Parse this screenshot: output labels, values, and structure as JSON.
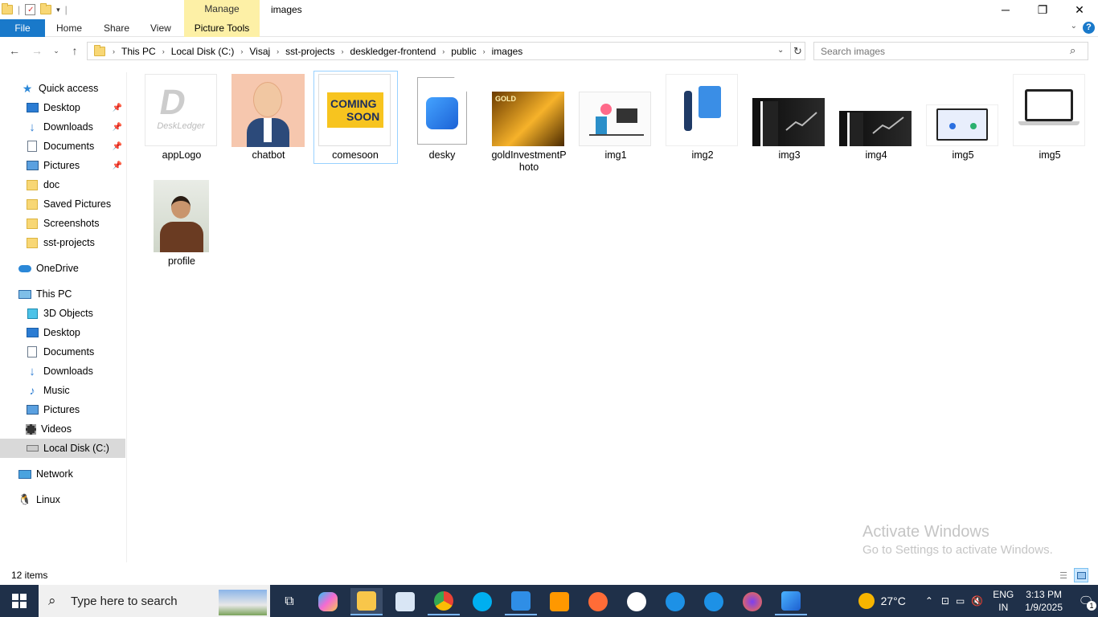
{
  "window": {
    "title": "images",
    "contextual_tab": "Manage",
    "contextual_group": "Picture Tools",
    "controls": {
      "minimize": "─",
      "maximize": "❐",
      "close": "✕"
    }
  },
  "ribbon": {
    "file": "File",
    "tabs": [
      "Home",
      "Share",
      "View"
    ],
    "picture_tools": "Picture Tools",
    "help": "?"
  },
  "address": {
    "crumbs": [
      "This PC",
      "Local Disk (C:)",
      "Visaj",
      "sst-projects",
      "deskledger-frontend",
      "public",
      "images"
    ]
  },
  "search": {
    "placeholder": "Search images"
  },
  "nav": {
    "quick_access": "Quick access",
    "qa_items": [
      "Desktop",
      "Downloads",
      "Documents",
      "Pictures",
      "doc",
      "Saved Pictures",
      "Screenshots",
      "sst-projects"
    ],
    "onedrive": "OneDrive",
    "this_pc": "This PC",
    "pc_items": [
      "3D Objects",
      "Desktop",
      "Documents",
      "Downloads",
      "Music",
      "Pictures",
      "Videos",
      "Local Disk (C:)"
    ],
    "network": "Network",
    "linux": "Linux"
  },
  "files": [
    {
      "name": "appLogo"
    },
    {
      "name": "chatbot"
    },
    {
      "name": "comesoon"
    },
    {
      "name": "desky"
    },
    {
      "name": "goldInvestmentPhoto",
      "line1": "goldInvestmentP",
      "line2": "hoto"
    },
    {
      "name": "img1"
    },
    {
      "name": "img2"
    },
    {
      "name": "img3"
    },
    {
      "name": "img4"
    },
    {
      "name": "img5"
    },
    {
      "name": "img5"
    },
    {
      "name": "profile"
    }
  ],
  "thumb_text": {
    "applogo": "DeskLedger",
    "coming": "COMING",
    "soon": "SOON",
    "gold": "GOLD"
  },
  "watermark": {
    "line1": "Activate Windows",
    "line2": "Go to Settings to activate Windows."
  },
  "status": {
    "items": "12 items"
  },
  "taskbar": {
    "search_placeholder": "Type here to search",
    "weather": "27°C",
    "lang1": "ENG",
    "lang2": "IN",
    "time": "3:13 PM",
    "date": "1/9/2025",
    "notif_count": "1"
  },
  "colors": {
    "accent": "#1979ca",
    "taskbar": "#1f3049",
    "picture_tools": "#fdf0a6",
    "selection": "#cce8ff"
  }
}
